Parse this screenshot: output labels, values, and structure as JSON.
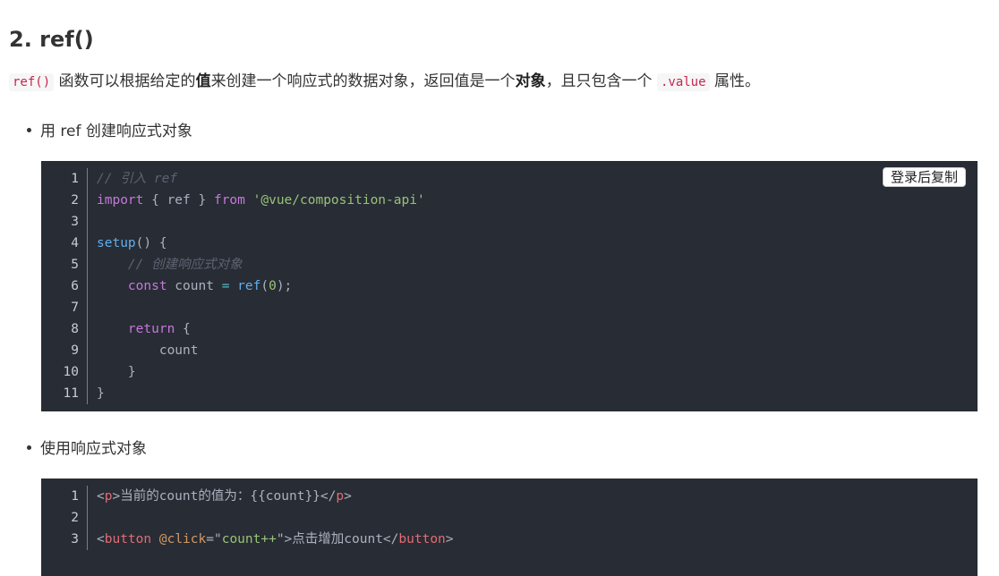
{
  "heading": "2. ref()",
  "intro": {
    "code1": "ref()",
    "text1": " 函数可以根据给定的",
    "bold1": "值",
    "text2": "来创建一个响应式的数据对象，返回值是一个",
    "bold2": "对象",
    "text3": "，且只包含一个 ",
    "code2": ".value",
    "text4": " 属性。"
  },
  "bullet1": "用 ref 创建响应式对象",
  "bullet2": "使用响应式对象",
  "copy_button": "登录后复制",
  "block1": {
    "lines": [
      {
        "n": "1",
        "parts": [
          {
            "t": "// 引入 ref",
            "c": "cm"
          }
        ]
      },
      {
        "n": "2",
        "parts": [
          {
            "t": "import",
            "c": "kw"
          },
          {
            "t": " { ref } ",
            "c": ""
          },
          {
            "t": "from",
            "c": "kw"
          },
          {
            "t": " ",
            "c": ""
          },
          {
            "t": "'@vue/composition-api'",
            "c": "str"
          }
        ]
      },
      {
        "n": "3",
        "parts": []
      },
      {
        "n": "4",
        "parts": [
          {
            "t": "setup",
            "c": "fn"
          },
          {
            "t": "() {",
            "c": ""
          }
        ]
      },
      {
        "n": "5",
        "parts": [
          {
            "t": "    ",
            "c": ""
          },
          {
            "t": "// 创建响应式对象",
            "c": "cm"
          }
        ]
      },
      {
        "n": "6",
        "parts": [
          {
            "t": "    ",
            "c": ""
          },
          {
            "t": "const",
            "c": "kw"
          },
          {
            "t": " count ",
            "c": ""
          },
          {
            "t": "=",
            "c": "op"
          },
          {
            "t": " ",
            "c": ""
          },
          {
            "t": "ref",
            "c": "fn"
          },
          {
            "t": "(",
            "c": ""
          },
          {
            "t": "0",
            "c": "num"
          },
          {
            "t": ");",
            "c": ""
          }
        ]
      },
      {
        "n": "7",
        "parts": []
      },
      {
        "n": "8",
        "parts": [
          {
            "t": "    ",
            "c": ""
          },
          {
            "t": "return",
            "c": "kw"
          },
          {
            "t": " {",
            "c": ""
          }
        ]
      },
      {
        "n": "9",
        "parts": [
          {
            "t": "        count",
            "c": ""
          }
        ]
      },
      {
        "n": "10",
        "parts": [
          {
            "t": "    }",
            "c": ""
          }
        ]
      },
      {
        "n": "11",
        "parts": [
          {
            "t": "}",
            "c": ""
          }
        ]
      }
    ]
  },
  "block2": {
    "lines": [
      {
        "n": "1",
        "parts": [
          {
            "t": "<",
            "c": ""
          },
          {
            "t": "p",
            "c": "tag"
          },
          {
            "t": ">当前的count的值为：{{count}}</",
            "c": ""
          },
          {
            "t": "p",
            "c": "tag"
          },
          {
            "t": ">",
            "c": ""
          }
        ]
      },
      {
        "n": "2",
        "parts": []
      },
      {
        "n": "3",
        "parts": [
          {
            "t": "<",
            "c": ""
          },
          {
            "t": "button",
            "c": "tag"
          },
          {
            "t": " ",
            "c": ""
          },
          {
            "t": "@click",
            "c": "attr"
          },
          {
            "t": "=\"",
            "c": ""
          },
          {
            "t": "count++",
            "c": "str"
          },
          {
            "t": "\">点击增加count</",
            "c": ""
          },
          {
            "t": "button",
            "c": "tag"
          },
          {
            "t": ">",
            "c": ""
          }
        ]
      }
    ]
  }
}
